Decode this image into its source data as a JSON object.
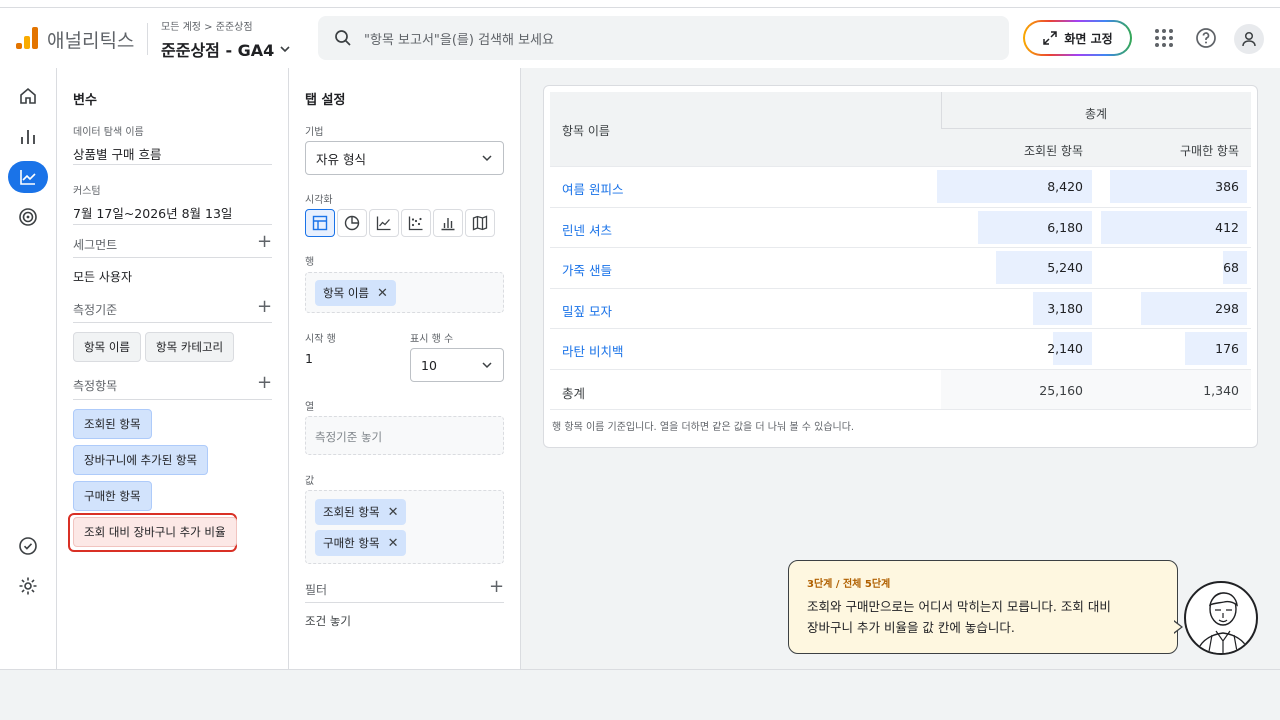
{
  "header": {
    "brand": "애널리틱스",
    "breadcrumb_account": "모든 계정",
    "breadcrumb_sep": ">",
    "breadcrumb_property": "준준상점",
    "property": "준준상점 - GA4",
    "search_placeholder": "\"항목 보고서\"을(를) 검색해 보세요",
    "pin_button": "화면 고정"
  },
  "variables": {
    "title": "변수",
    "exploration_name_label": "데이터 탐색 이름",
    "exploration_name": "상품별 구매 흐름",
    "date_label": "커스텀",
    "date_range": "7월 17일~2026년 8월 13일",
    "segments_title": "세그먼트",
    "segment_value": "모든 사용자",
    "dimensions_title": "측정기준",
    "dimensions": [
      "항목 이름",
      "항목 카테고리"
    ],
    "metrics_title": "측정항목",
    "metrics": [
      "조회된 항목",
      "장바구니에 추가된 항목",
      "구매한 항목",
      "조회 대비 장바구니 추가 비율"
    ]
  },
  "tab_settings": {
    "title": "탭 설정",
    "technique_label": "기법",
    "technique": "자유 형식",
    "visualization_label": "시각화",
    "rows_label": "행",
    "rows": [
      "항목 이름"
    ],
    "start_row_label": "시작 행",
    "start_row": "1",
    "show_rows_label": "표시 행 수",
    "show_rows": "10",
    "columns_label": "열",
    "columns_placeholder": "측정기준 놓기",
    "values_label": "값",
    "values": [
      "조회된 항목",
      "구매한 항목"
    ],
    "filters_label": "필터",
    "filters_placeholder": "조건 놓기"
  },
  "table": {
    "row_header": "항목 이름",
    "group_header": "총계",
    "col1": "조회된 항목",
    "col2": "구매한 항목",
    "rows": [
      {
        "name": "여름 원피스",
        "views": "8,420",
        "purchased": "386"
      },
      {
        "name": "린넨 셔츠",
        "views": "6,180",
        "purchased": "412"
      },
      {
        "name": "가죽 샌들",
        "views": "5,240",
        "purchased": "68"
      },
      {
        "name": "밀짚 모자",
        "views": "3,180",
        "purchased": "298"
      },
      {
        "name": "라탄 비치백",
        "views": "2,140",
        "purchased": "176"
      }
    ],
    "bar_fractions_views": [
      1.0,
      0.734,
      0.622,
      0.378,
      0.254
    ],
    "bar_fractions_purchased": [
      0.937,
      1.0,
      0.165,
      0.723,
      0.427
    ],
    "total_label": "총계",
    "total_views": "25,160",
    "total_purchased": "1,340",
    "footnote": "행 항목 이름 기준입니다. 열을 더하면 같은 값을 더 나눠 볼 수 있습니다."
  },
  "tooltip": {
    "step": "3단계 / 전체 5단계",
    "line1": "조회와 구매만으로는 어디서 막히는지 모릅니다. 조회 대비",
    "line2": "장바구니 추가 비율을 값 칸에 놓습니다."
  },
  "colors": {
    "accent": "#1a73e8",
    "highlight_ring": "#d93025",
    "tooltip_bg": "#fef7e0"
  }
}
